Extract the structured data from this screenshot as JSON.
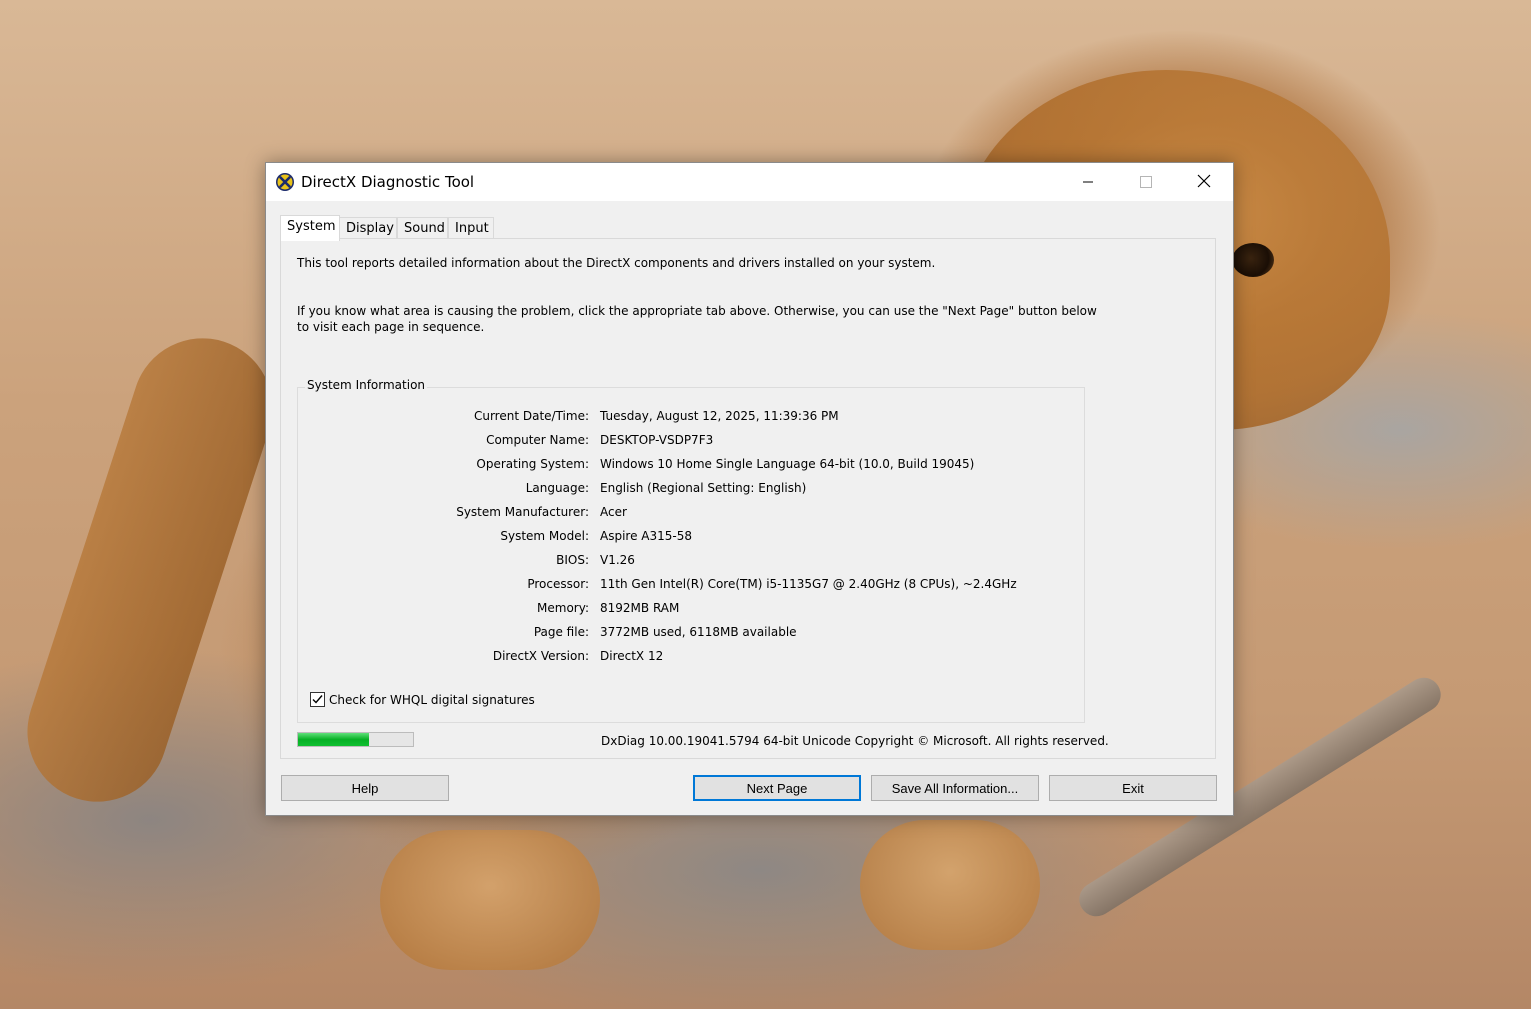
{
  "window": {
    "title": "DirectX Diagnostic Tool",
    "icon": "directx-icon"
  },
  "titlebar_controls": [
    "minimize-icon",
    "maximize-icon",
    "close-icon"
  ],
  "tabs": [
    {
      "label": "System",
      "active": true
    },
    {
      "label": "Display",
      "active": false
    },
    {
      "label": "Sound",
      "active": false
    },
    {
      "label": "Input",
      "active": false
    }
  ],
  "intro": {
    "line1": "This tool reports detailed information about the DirectX components and drivers installed on your system.",
    "line2": "If you know what area is causing the problem, click the appropriate tab above.  Otherwise, you can use the \"Next Page\" button below to visit each page in sequence."
  },
  "system_info": {
    "title": "System Information",
    "rows": [
      {
        "label": "Current Date/Time:",
        "value": "Tuesday, August 12, 2025, 11:39:36 PM"
      },
      {
        "label": "Computer Name:",
        "value": "DESKTOP-VSDP7F3"
      },
      {
        "label": "Operating System:",
        "value": "Windows 10 Home Single Language 64-bit (10.0, Build 19045)"
      },
      {
        "label": "Language:",
        "value": "English (Regional Setting: English)"
      },
      {
        "label": "System Manufacturer:",
        "value": "Acer"
      },
      {
        "label": "System Model:",
        "value": "Aspire A315-58"
      },
      {
        "label": "BIOS:",
        "value": "V1.26"
      },
      {
        "label": "Processor:",
        "value": "11th Gen Intel(R) Core(TM) i5-1135G7 @ 2.40GHz (8 CPUs), ~2.4GHz"
      },
      {
        "label": "Memory:",
        "value": "8192MB RAM"
      },
      {
        "label": "Page file:",
        "value": "3772MB used, 6118MB available"
      },
      {
        "label": "DirectX Version:",
        "value": "DirectX 12"
      }
    ]
  },
  "whql": {
    "label": "Check for WHQL digital signatures",
    "checked": true
  },
  "progress": {
    "fraction": 0.62,
    "color": "#06b025"
  },
  "footer": {
    "copyright": "DxDiag 10.00.19041.5794 64-bit Unicode  Copyright © Microsoft. All rights reserved."
  },
  "buttons": {
    "help": "Help",
    "next_page": "Next Page",
    "save_all": "Save All Information...",
    "exit": "Exit"
  },
  "colors": {
    "accent": "#0078d7",
    "window_bg": "#f0f0f0"
  }
}
